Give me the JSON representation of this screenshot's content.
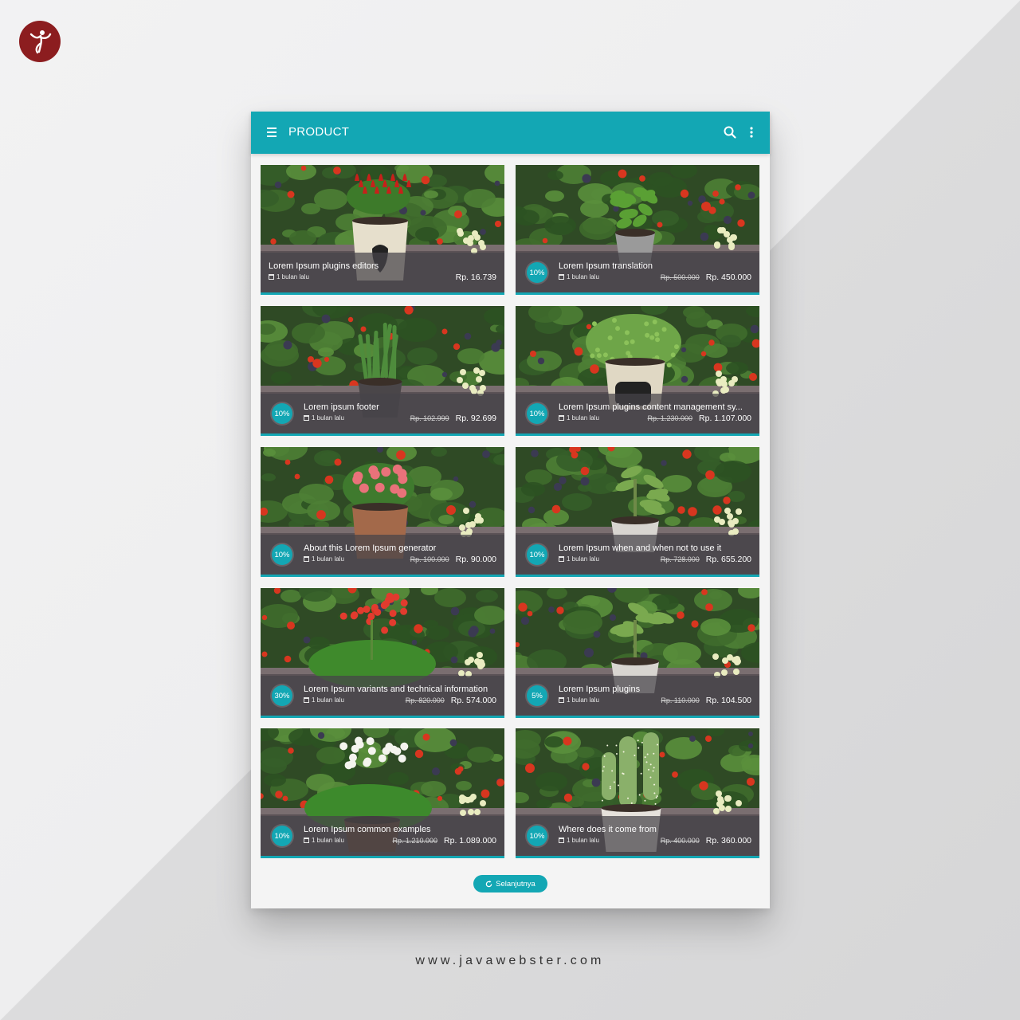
{
  "appbar": {
    "title": "PRODUCT",
    "color": "#13a7b4"
  },
  "products": [
    {
      "title": "Lorem Ipsum plugins editors",
      "time": "1 bulan lalu",
      "discount": "",
      "old_price": "",
      "price": "Rp. 16.739",
      "plant": "chili"
    },
    {
      "title": "Lorem Ipsum translation",
      "time": "1 bulan lalu",
      "discount": "10%",
      "old_price": "Rp. 500.000",
      "price": "Rp. 450.000",
      "plant": "basil"
    },
    {
      "title": "Lorem ipsum footer",
      "time": "1 bulan lalu",
      "discount": "10%",
      "old_price": "Rp. 102.999",
      "price": "Rp. 92.699",
      "plant": "succulent"
    },
    {
      "title": "Lorem Ipsum plugins content management sy...",
      "time": "1 bulan lalu",
      "discount": "10%",
      "old_price": "Rp. 1.230.000",
      "price": "Rp. 1.107.000",
      "plant": "fern"
    },
    {
      "title": "About this Lorem Ipsum generator",
      "time": "1 bulan lalu",
      "discount": "10%",
      "old_price": "Rp. 100.000",
      "price": "Rp. 90.000",
      "plant": "pinkflower"
    },
    {
      "title": "Lorem Ipsum when and when not to use it",
      "time": "1 bulan lalu",
      "discount": "10%",
      "old_price": "Rp. 728.000",
      "price": "Rp. 655.200",
      "plant": "jade"
    },
    {
      "title": "Lorem Ipsum variants and technical information",
      "time": "1 bulan lalu",
      "discount": "30%",
      "old_price": "Rp. 820.000",
      "price": "Rp. 574.000",
      "plant": "redflower"
    },
    {
      "title": "Lorem Ipsum plugins",
      "time": "1 bulan lalu",
      "discount": "5%",
      "old_price": "Rp. 110.000",
      "price": "Rp. 104.500",
      "plant": "jade2"
    },
    {
      "title": "Lorem Ipsum common examples",
      "time": "1 bulan lalu",
      "discount": "10%",
      "old_price": "Rp. 1.210.000",
      "price": "Rp. 1.089.000",
      "plant": "whiteflower"
    },
    {
      "title": "Where does it come from",
      "time": "1 bulan lalu",
      "discount": "10%",
      "old_price": "Rp. 400.000",
      "price": "Rp. 360.000",
      "plant": "cactus"
    }
  ],
  "next_button": {
    "label": "Selanjutnya"
  },
  "footer": {
    "url": "www.javawebster.com"
  }
}
